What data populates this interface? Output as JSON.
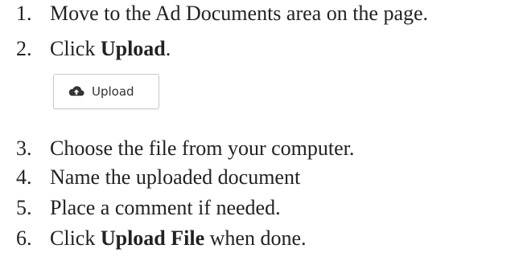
{
  "steps": [
    {
      "number": "1.",
      "text": "Move to the Ad Documents area on the page."
    },
    {
      "number": "2.",
      "prefix": "Click ",
      "bold": "Upload",
      "suffix": "."
    },
    {
      "number": "3.",
      "text": "Choose the file from your computer."
    },
    {
      "number": "4.",
      "text": "Name the uploaded document"
    },
    {
      "number": "5.",
      "text": "Place a comment if needed."
    },
    {
      "number": "6.",
      "prefix": "Click ",
      "bold": "Upload File",
      "suffix": " when done."
    }
  ],
  "upload_button": {
    "label": "Upload",
    "icon": "cloud-upload-icon"
  },
  "colors": {
    "text": "#222222",
    "button_border": "#c8c8c8",
    "icon": "#333333"
  }
}
